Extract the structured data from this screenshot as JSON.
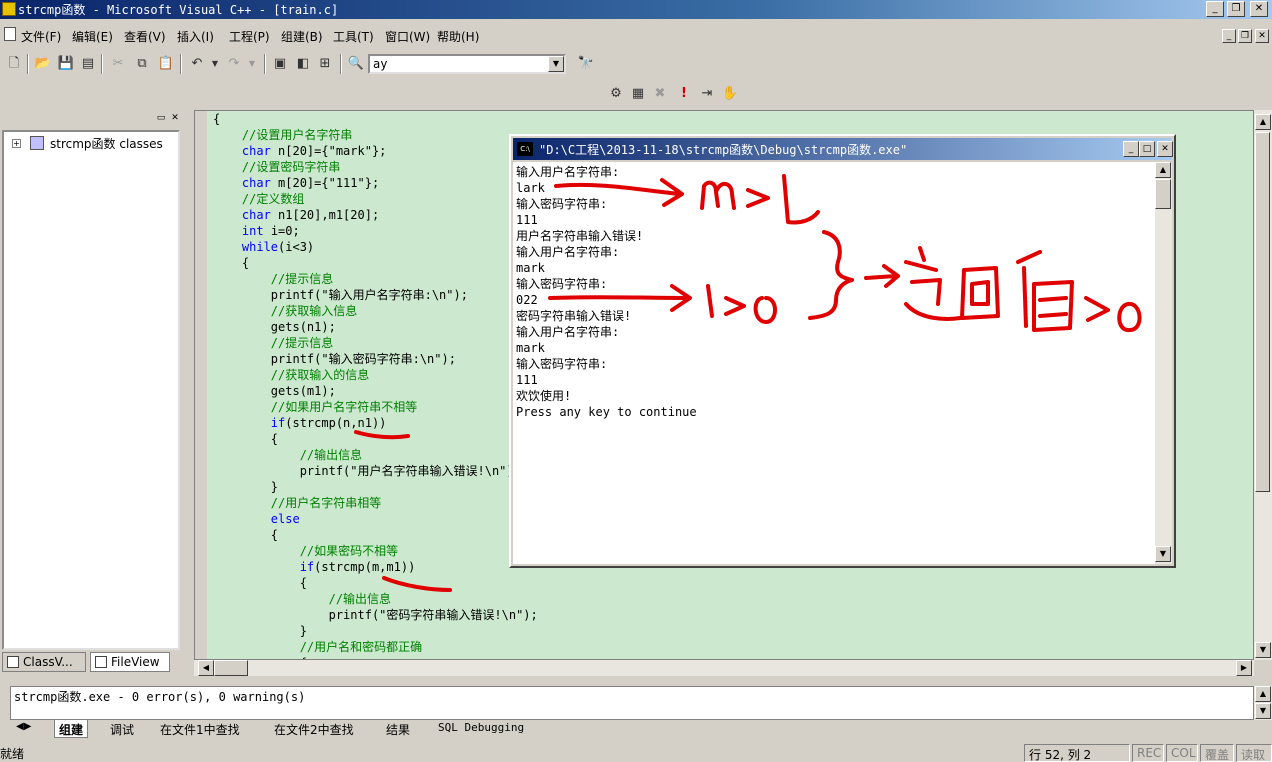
{
  "window": {
    "title": "strcmp函数 - Microsoft Visual C++ - [train.c]",
    "minimize": "_",
    "restore": "❐",
    "close": "✕"
  },
  "menu": {
    "items": [
      "文件(F)",
      "编辑(E)",
      "查看(V)",
      "插入(I)",
      "工程(P)",
      "组建(B)",
      "工具(T)",
      "窗口(W)",
      "帮助(H)"
    ]
  },
  "toolbar": {
    "find_combo_value": "ay",
    "buttons": [
      "new-file-icon",
      "open-folder-icon",
      "save-icon",
      "save-all-icon",
      "cut-icon",
      "copy-icon",
      "paste-icon",
      "undo-icon",
      "redo-icon",
      "workspace-icon",
      "output-icon",
      "window-list-icon",
      "find-in-files-icon",
      "find-icon"
    ],
    "build_buttons": [
      "compile-icon",
      "build-icon",
      "stop-build-icon",
      "execute-icon",
      "go-icon",
      "breakpoint-icon"
    ]
  },
  "workspace": {
    "tree_root": "strcmp函数 classes",
    "tabs": [
      "ClassV...",
      "FileView"
    ]
  },
  "editor": {
    "lines": [
      [
        [
          "p",
          "{"
        ]
      ],
      [
        [
          "p",
          "    "
        ],
        [
          "c",
          "//设置用户名字符串"
        ]
      ],
      [
        [
          "p",
          "    "
        ],
        [
          "k",
          "char"
        ],
        [
          "p",
          " n[20]={\"mark\"};"
        ]
      ],
      [
        [
          "p",
          "    "
        ],
        [
          "c",
          "//设置密码字符串"
        ]
      ],
      [
        [
          "p",
          "    "
        ],
        [
          "k",
          "char"
        ],
        [
          "p",
          " m[20]={\"111\"};"
        ]
      ],
      [
        [
          "p",
          "    "
        ],
        [
          "c",
          "//定义数组"
        ]
      ],
      [
        [
          "p",
          "    "
        ],
        [
          "k",
          "char"
        ],
        [
          "p",
          " n1[20],m1[20];"
        ]
      ],
      [
        [
          "p",
          "    "
        ],
        [
          "k",
          "int"
        ],
        [
          "p",
          " i=0;"
        ]
      ],
      [
        [
          "p",
          "    "
        ],
        [
          "k",
          "while"
        ],
        [
          "p",
          "(i<3)"
        ]
      ],
      [
        [
          "p",
          "    {"
        ]
      ],
      [
        [
          "p",
          "        "
        ],
        [
          "c",
          "//提示信息"
        ]
      ],
      [
        [
          "p",
          "        printf(\"输入用户名字符串:\\n\");"
        ]
      ],
      [
        [
          "p",
          "        "
        ],
        [
          "c",
          "//获取输入信息"
        ]
      ],
      [
        [
          "p",
          "        gets(n1);"
        ]
      ],
      [
        [
          "p",
          "        "
        ],
        [
          "c",
          "//提示信息"
        ]
      ],
      [
        [
          "p",
          "        printf(\"输入密码字符串:\\n\");"
        ]
      ],
      [
        [
          "p",
          "        "
        ],
        [
          "c",
          "//获取输入的信息"
        ]
      ],
      [
        [
          "p",
          "        gets(m1);"
        ]
      ],
      [
        [
          "p",
          "        "
        ],
        [
          "c",
          "//如果用户名字符串不相等"
        ]
      ],
      [
        [
          "p",
          "        "
        ],
        [
          "k",
          "if"
        ],
        [
          "p",
          "(strcmp(n,n1))"
        ]
      ],
      [
        [
          "p",
          "        {"
        ]
      ],
      [
        [
          "p",
          "            "
        ],
        [
          "c",
          "//输出信息"
        ]
      ],
      [
        [
          "p",
          "            printf(\"用户名字符串输入错误!\\n\");"
        ]
      ],
      [
        [
          "p",
          "        }"
        ]
      ],
      [
        [
          "p",
          "        "
        ],
        [
          "c",
          "//用户名字符串相等"
        ]
      ],
      [
        [
          "p",
          "        "
        ],
        [
          "k",
          "else"
        ]
      ],
      [
        [
          "p",
          "        {"
        ]
      ],
      [
        [
          "p",
          "            "
        ],
        [
          "c",
          "//如果密码不相等"
        ]
      ],
      [
        [
          "p",
          "            "
        ],
        [
          "k",
          "if"
        ],
        [
          "p",
          "(strcmp(m,m1))"
        ]
      ],
      [
        [
          "p",
          "            {"
        ]
      ],
      [
        [
          "p",
          "                "
        ],
        [
          "c",
          "//输出信息"
        ]
      ],
      [
        [
          "p",
          "                printf(\"密码字符串输入错误!\\n\");"
        ]
      ],
      [
        [
          "p",
          "            }"
        ]
      ],
      [
        [
          "p",
          "            "
        ],
        [
          "c",
          "//用户名和密码都正确"
        ]
      ],
      [
        [
          "p",
          "            {"
        ]
      ]
    ]
  },
  "console": {
    "title": "\"D:\\C工程\\2013-11-18\\strcmp函数\\Debug\\strcmp函数.exe\"",
    "icon_text": "C:\\",
    "output": [
      "输入用户名字符串:",
      "lark",
      "输入密码字符串:",
      "111",
      "用户名字符串输入错误!",
      "输入用户名字符串:",
      "mark",
      "输入密码字符串:",
      "022",
      "密码字符串输入错误!",
      "输入用户名字符串:",
      "mark",
      "输入密码字符串:",
      "111",
      "欢饮使用!",
      "Press any key to continue"
    ]
  },
  "output_pane": {
    "text": "strcmp函数.exe - 0 error(s), 0 warning(s)",
    "tabs": [
      "组建",
      "调试",
      "在文件1中查找",
      "在文件2中查找",
      "结果",
      "SQL Debugging"
    ]
  },
  "statusbar": {
    "message": "就绪",
    "position": "行 52, 列 2",
    "indicators": [
      "REC",
      "COL",
      "覆盖",
      "读取"
    ]
  },
  "colors": {
    "editor_bg": "#cce8cf",
    "keyword": "#0000ff",
    "comment": "#008000",
    "annotation_ink": "#e00000"
  }
}
